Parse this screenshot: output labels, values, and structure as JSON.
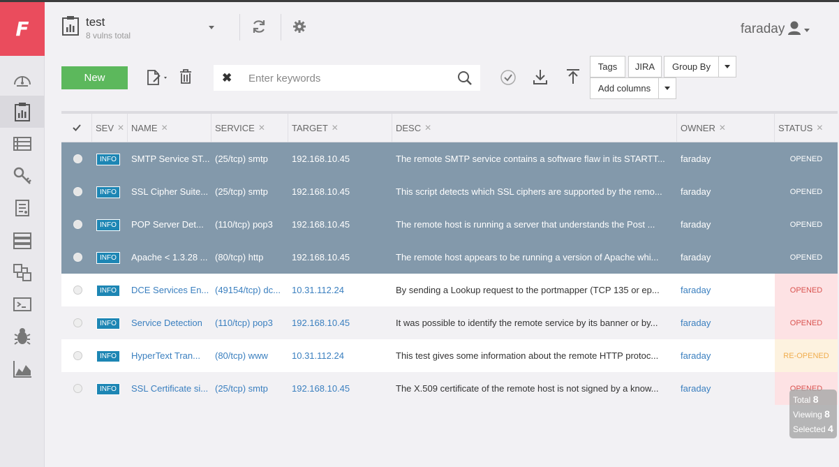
{
  "app": {
    "logo_letter": "F"
  },
  "sidebar": {
    "items": [
      {
        "name": "dashboard",
        "icon": "gauge-icon"
      },
      {
        "name": "status-report",
        "icon": "clipboard-chart-icon",
        "active": true
      },
      {
        "name": "hosts",
        "icon": "list-icon"
      },
      {
        "name": "credentials",
        "icon": "key-icon"
      },
      {
        "name": "executive-report",
        "icon": "report-icon"
      },
      {
        "name": "workspaces",
        "icon": "servers-icon"
      },
      {
        "name": "comparison",
        "icon": "compare-icon"
      },
      {
        "name": "console",
        "icon": "terminal-icon"
      },
      {
        "name": "vuln-templates",
        "icon": "bug-icon"
      },
      {
        "name": "analytics",
        "icon": "area-chart-icon"
      }
    ]
  },
  "header": {
    "workspace_name": "test",
    "vulns_total": "8 vulns total",
    "user_name": "faraday"
  },
  "toolbar": {
    "new_label": "New",
    "search_placeholder": "Enter keywords",
    "search_value": "",
    "tags_label": "Tags",
    "jira_label": "JIRA",
    "group_by_label": "Group By",
    "add_columns_label": "Add columns"
  },
  "table": {
    "columns": [
      "SEV",
      "NAME",
      "SERVICE",
      "TARGET",
      "DESC",
      "OWNER",
      "STATUS"
    ],
    "rows": [
      {
        "selected": true,
        "sev": "INFO",
        "name": "SMTP Service ST...",
        "service": "(25/tcp) smtp",
        "target": "192.168.10.45",
        "desc": "The remote SMTP service contains a software flaw in its STARTT...",
        "owner": "faraday",
        "status": "OPENED",
        "status_kind": "opened"
      },
      {
        "selected": true,
        "sev": "INFO",
        "name": "SSL Cipher Suite...",
        "service": "(25/tcp) smtp",
        "target": "192.168.10.45",
        "desc": "This script detects which SSL ciphers are supported by the remo...",
        "owner": "faraday",
        "status": "OPENED",
        "status_kind": "opened"
      },
      {
        "selected": true,
        "sev": "INFO",
        "name": "POP Server Det...",
        "service": "(110/tcp) pop3",
        "target": "192.168.10.45",
        "desc": "The remote host is running a server that understands the Post ...",
        "owner": "faraday",
        "status": "OPENED",
        "status_kind": "opened"
      },
      {
        "selected": true,
        "sev": "INFO",
        "name": "Apache < 1.3.28 ...",
        "service": "(80/tcp) http",
        "target": "192.168.10.45",
        "desc": "The remote host appears to be running a version of Apache whi...",
        "owner": "faraday",
        "status": "OPENED",
        "status_kind": "opened"
      },
      {
        "selected": false,
        "sev": "INFO",
        "name": "DCE Services En...",
        "service": "(49154/tcp) dc...",
        "target": "10.31.112.24",
        "desc": "By sending a Lookup request to the portmapper (TCP 135 or ep...",
        "owner": "faraday",
        "status": "OPENED",
        "status_kind": "opened"
      },
      {
        "selected": false,
        "sev": "INFO",
        "name": "Service Detection",
        "service": "(110/tcp) pop3",
        "target": "192.168.10.45",
        "desc": "It was possible to identify the remote service by its banner or by...",
        "owner": "faraday",
        "status": "OPENED",
        "status_kind": "opened"
      },
      {
        "selected": false,
        "sev": "INFO",
        "name": "HyperText Tran...",
        "service": "(80/tcp) www",
        "target": "10.31.112.24",
        "desc": "This test gives some information about the remote HTTP protoc...",
        "owner": "faraday",
        "status": "RE-OPENED",
        "status_kind": "reopened"
      },
      {
        "selected": false,
        "sev": "INFO",
        "name": "SSL Certificate si...",
        "service": "(25/tcp) smtp",
        "target": "192.168.10.45",
        "desc": "The X.509 certificate of the remote host is not signed by a know...",
        "owner": "faraday",
        "status": "OPENED",
        "status_kind": "opened"
      }
    ]
  },
  "stats": {
    "total_label": "Total",
    "total": "8",
    "viewing_label": "Viewing",
    "viewing": "8",
    "selected_label": "Selected",
    "selected": "4"
  },
  "colors": {
    "brand": "#ea4c5d",
    "new_button": "#5cb85c",
    "selected_row": "#8399ab",
    "severity_info": "#1d86b4",
    "link": "#3a7fbf",
    "status_opened": "#d9534f",
    "status_reopened": "#f0ad4e"
  }
}
